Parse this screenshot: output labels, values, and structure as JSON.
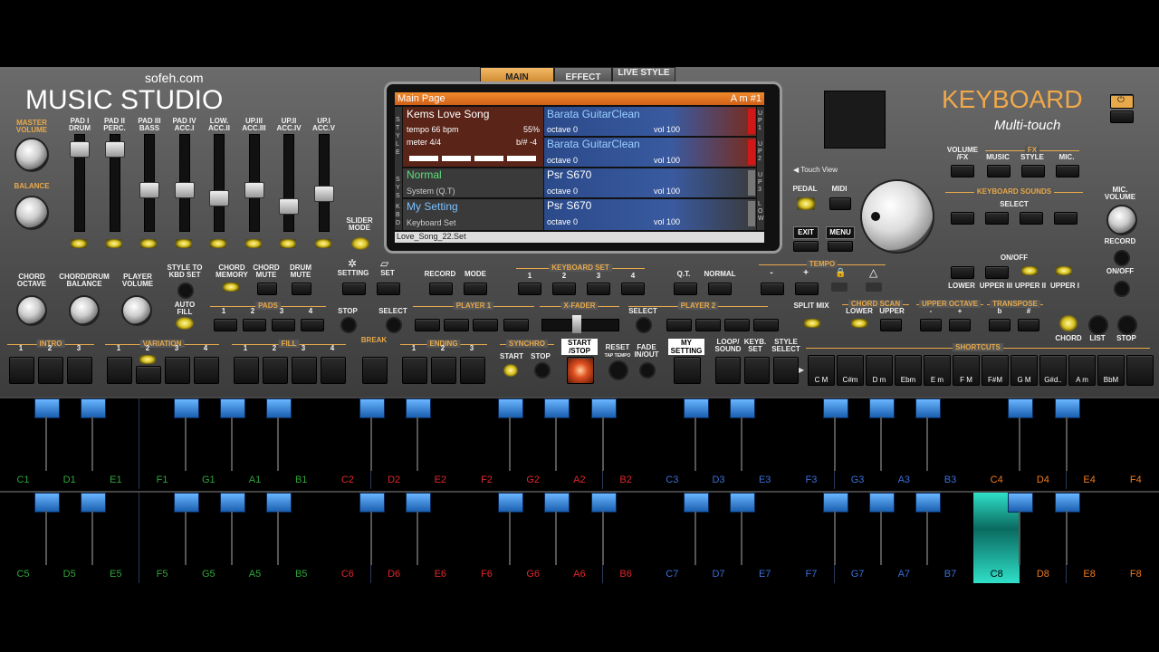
{
  "brand": {
    "site": "sofeh.com",
    "app_title": "MUSIC STUDIO",
    "keyboard_title": "KEYBOARD",
    "keyboard_sub": "Multi-touch"
  },
  "tabs": [
    "MAIN",
    "EFFECT",
    "LIVE STYLE"
  ],
  "screen": {
    "header": "Main Page",
    "header_right": "A m #1",
    "style_name": "Kems Love Song",
    "tempo": "tempo 66 bpm",
    "tempo_pct": "55%",
    "meter": "meter 4/4",
    "bsharp": "b/# -4",
    "normal": "Normal",
    "system": "System (Q.T)",
    "my_setting": "My Setting",
    "kbd_set": "Keyboard Set",
    "up1": "Barata GuitarClean",
    "up2": "Barata GuitarClean",
    "up3": "Psr S670",
    "low": "Psr S670",
    "octave": "octave  0",
    "vol": "vol 100",
    "side_left": [
      "STYLE",
      "SYS",
      "KBD"
    ],
    "side_right": [
      "UP1",
      "UP2",
      "UP3",
      "LOW"
    ],
    "footer": "Love_Song_22.Set"
  },
  "left": {
    "master_volume": "MASTER VOLUME",
    "balance": "BALANCE",
    "faders": [
      {
        "label": "PAD I DRUM",
        "level": 0.92
      },
      {
        "label": "PAD II PERC.",
        "level": 0.92
      },
      {
        "label": "PAD III BASS",
        "level": 0.42
      },
      {
        "label": "PAD IV ACC.I",
        "level": 0.42
      },
      {
        "label": "LOW. ACC.II",
        "level": 0.32
      },
      {
        "label": "UP.III ACC.III",
        "level": 0.42
      },
      {
        "label": "UP.II ACC.IV",
        "level": 0.22
      },
      {
        "label": "UP.I ACC.V",
        "level": 0.38
      }
    ],
    "slider_mode": "SLIDER MODE",
    "chord_octave": "CHORD OCTAVE",
    "chord_drum_balance": "CHORD/DRUM BALANCE",
    "player_volume": "PLAYER VOLUME",
    "style_to_kbd": "STYLE TO KBD SET",
    "chord_memory": "CHORD MEMORY",
    "chord_mute": "CHORD MUTE",
    "drum_mute": "DRUM MUTE",
    "setting": "SETTING",
    "set": "SET",
    "auto_fill": "AUTO FILL",
    "pads": "PADS",
    "stop": "STOP",
    "intro": "INTRO",
    "variation": "VARIATION",
    "fill": "FILL",
    "break": "BREAK",
    "ending": "ENDING",
    "synchro": "SYNCHRO",
    "start": "START",
    "start_stop": "START /STOP",
    "reset": "RESET",
    "taptempo": "TAP TEMPO",
    "fade": "FADE IN/OUT",
    "my_setting": "MY SETTING",
    "loop_sound": "LOOP/ SOUND",
    "keyb_set": "KEYB. SET",
    "style_select": "STYLE SELECT"
  },
  "mid": {
    "record": "RECORD",
    "mode": "MODE",
    "keyboard_set": "KEYBOARD SET",
    "qt": "Q.T.",
    "normal": "NORMAL",
    "tempo": "TEMPO",
    "minus": "-",
    "plus": "+",
    "player1": "PLAYER 1",
    "xfader": "X-FADER",
    "player2": "PLAYER 2",
    "select": "SELECT",
    "nums": [
      "1",
      "2",
      "3",
      "4"
    ]
  },
  "right": {
    "volume_fx": "VOLUME /FX",
    "fx": "FX",
    "music": "MUSIC",
    "style": "STYLE",
    "mic": "MIC.",
    "touch_view": "Touch View",
    "pedal": "PEDAL",
    "midi": "MIDI",
    "exit": "EXIT",
    "menu": "MENU",
    "keyboard_sounds": "KEYBOARD SOUNDS",
    "select": "SELECT",
    "on_off": "ON/OFF",
    "lower": "LOWER",
    "upper3": "UPPER III",
    "upper2": "UPPER II",
    "upper1": "UPPER I",
    "mic_volume": "MIC. VOLUME",
    "record": "RECORD",
    "onoff2": "ON/OFF",
    "split_mix": "SPLIT MIX",
    "chord_scan": "CHORD SCAN",
    "upper_octave": "UPPER OCTAVE",
    "transpose": "TRANSPOSE",
    "cs_lower": "LOWER",
    "cs_upper": "UPPER",
    "b": "b",
    "sharp": "#",
    "chord": "CHORD",
    "list": "LIST",
    "stop": "STOP",
    "shortcuts": "SHORTCUTS",
    "chords": [
      "C M",
      "C#m",
      "D m",
      "Ebm",
      "E m",
      "F M",
      "F#M",
      "G M",
      "G#d..",
      "A m",
      "BbM"
    ]
  },
  "keyboard": {
    "row1": [
      "C1",
      "D1",
      "E1",
      "F1",
      "G1",
      "A1",
      "B1",
      "C2",
      "D2",
      "E2",
      "F2",
      "G2",
      "A2",
      "B2",
      "C3",
      "D3",
      "E3",
      "F3",
      "G3",
      "A3",
      "B3",
      "C4",
      "D4",
      "E4",
      "F4"
    ],
    "row2": [
      "C5",
      "D5",
      "E5",
      "F5",
      "G5",
      "A5",
      "B5",
      "C6",
      "D6",
      "E6",
      "F6",
      "G6",
      "A6",
      "B6",
      "C7",
      "D7",
      "E7",
      "F7",
      "G7",
      "A7",
      "B7",
      "C8",
      "D8",
      "E8",
      "F8"
    ],
    "colors": {
      "green": "#2fa43a",
      "red": "#e0262a",
      "blue": "#3b6fd6",
      "orange": "#f07a1e",
      "pressed": "#2fe0c8"
    }
  }
}
